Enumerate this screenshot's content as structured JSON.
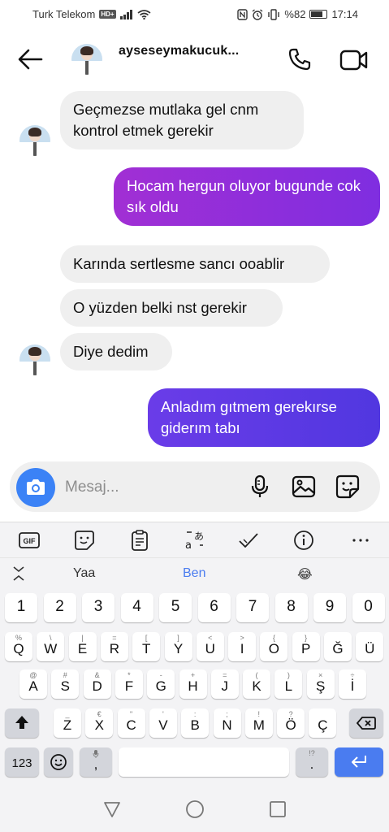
{
  "status": {
    "carrier": "Turk Telekom",
    "hd_badge": "HD+",
    "battery": "%82",
    "battery_level": 0.82,
    "time": "17:14"
  },
  "header": {
    "contact_name": "ayseseymakucuk..."
  },
  "messages": [
    {
      "side": "in",
      "text": "Geçmezse mutlaka gel cnm kontrol etmek gerekir"
    },
    {
      "side": "out",
      "text": "Hocam hergun oluyor bugunde cok sık oldu"
    },
    {
      "side": "in",
      "text": "Karında sertlesme sancı ooablir"
    },
    {
      "side": "in",
      "text": "O yüzden belki nst gerekir"
    },
    {
      "side": "in",
      "text": "Diye dedim"
    },
    {
      "side": "out",
      "text": "Anladım gıtmem gerekırse giderım tabı"
    }
  ],
  "composer": {
    "placeholder": "Mesaj..."
  },
  "keyboard": {
    "toolbar_gif": "GIF",
    "suggestions": [
      "Yaa",
      "Ben",
      "😂"
    ],
    "number_row": [
      "1",
      "2",
      "3",
      "4",
      "5",
      "6",
      "7",
      "8",
      "9",
      "0"
    ],
    "row1": [
      {
        "main": "Q",
        "sub": "%"
      },
      {
        "main": "W",
        "sub": "\\"
      },
      {
        "main": "E",
        "sub": "|"
      },
      {
        "main": "R",
        "sub": "="
      },
      {
        "main": "T",
        "sub": "["
      },
      {
        "main": "Y",
        "sub": "]"
      },
      {
        "main": "U",
        "sub": "<"
      },
      {
        "main": "I",
        "sub": ">"
      },
      {
        "main": "O",
        "sub": "{"
      },
      {
        "main": "P",
        "sub": "}"
      },
      {
        "main": "Ğ",
        "sub": ""
      },
      {
        "main": "Ü",
        "sub": ""
      }
    ],
    "row2": [
      {
        "main": "A",
        "sub": "@"
      },
      {
        "main": "S",
        "sub": "#"
      },
      {
        "main": "D",
        "sub": "&"
      },
      {
        "main": "F",
        "sub": "*"
      },
      {
        "main": "G",
        "sub": "-"
      },
      {
        "main": "H",
        "sub": "+"
      },
      {
        "main": "J",
        "sub": "="
      },
      {
        "main": "K",
        "sub": "("
      },
      {
        "main": "L",
        "sub": ")"
      },
      {
        "main": "Ş",
        "sub": "×"
      },
      {
        "main": "İ",
        "sub": "÷"
      }
    ],
    "row3": [
      {
        "main": "Z",
        "sub": "_"
      },
      {
        "main": "X",
        "sub": "€"
      },
      {
        "main": "C",
        "sub": "\""
      },
      {
        "main": "V",
        "sub": "'"
      },
      {
        "main": "B",
        "sub": ":"
      },
      {
        "main": "N",
        "sub": ";"
      },
      {
        "main": "M",
        "sub": "!"
      },
      {
        "main": "Ö",
        "sub": "?"
      },
      {
        "main": "Ç",
        "sub": ""
      }
    ],
    "numbers_key": "123",
    "period_sub": "!?",
    "period": ".",
    "comma": ","
  }
}
